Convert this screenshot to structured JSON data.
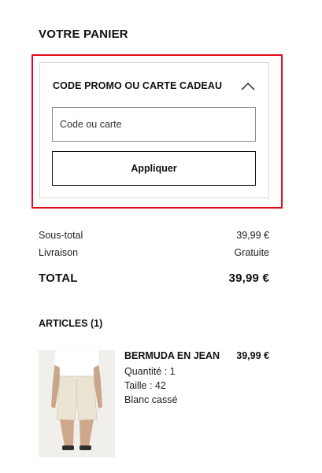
{
  "cart": {
    "title": "VOTRE PANIER"
  },
  "promo": {
    "title": "CODE PROMO OU CARTE CADEAU",
    "toggle_icon": "chevron-up-icon",
    "input_placeholder": "Code ou carte",
    "input_value": "",
    "apply_label": "Appliquer",
    "highlight_color": "#e30b17"
  },
  "summary": {
    "subtotal_label": "Sous-total",
    "subtotal_value": "39,99 €",
    "shipping_label": "Livraison",
    "shipping_value": "Gratuite",
    "total_label": "TOTAL",
    "total_value": "39,99 €"
  },
  "articles": {
    "title": "ARTICLES (1)",
    "items": [
      {
        "name": "BERMUDA EN JEAN",
        "price": "39,99 €",
        "quantity": "Quantité : 1",
        "size": "Taille : 42",
        "color": "Blanc cassé",
        "image": "product-photo-icon"
      }
    ]
  }
}
